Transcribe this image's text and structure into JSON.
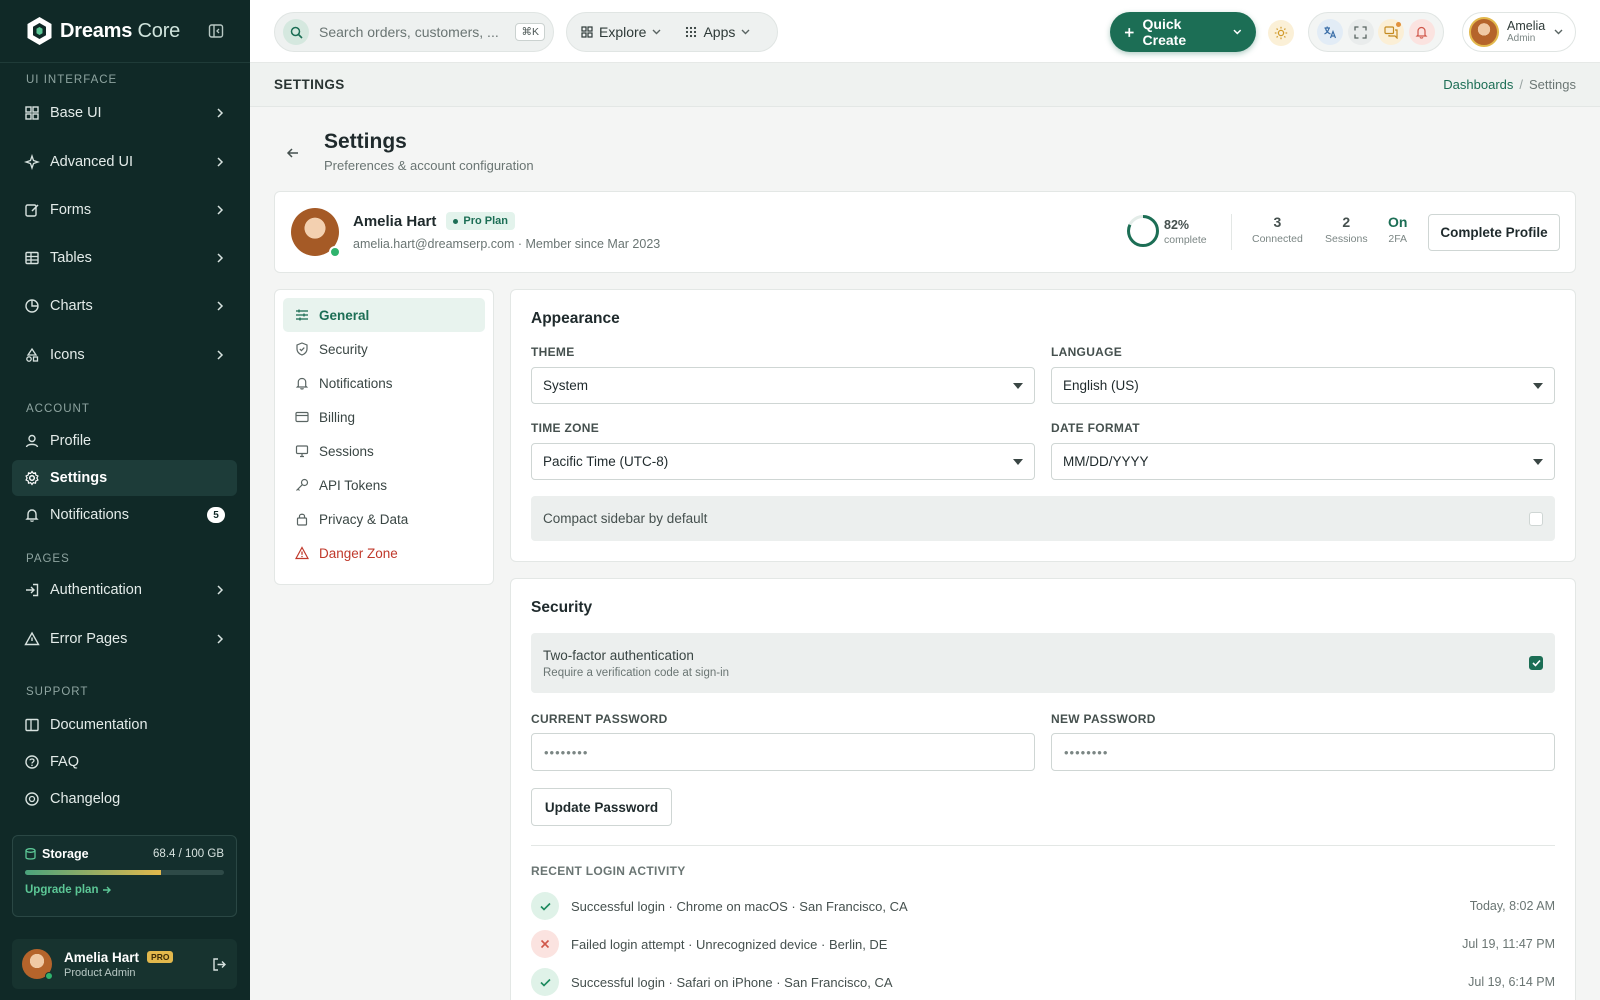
{
  "brand": {
    "name_a": "Dreams",
    "name_b": " Core"
  },
  "sidebar": {
    "sections": {
      "ui": "UI INTERFACE",
      "account": "ACCOUNT",
      "pages": "PAGES",
      "support": "SUPPORT"
    },
    "ui_items": [
      {
        "label": "Base UI",
        "icon": "grid-icon"
      },
      {
        "label": "Advanced UI",
        "icon": "sparkle-icon"
      },
      {
        "label": "Forms",
        "icon": "edit-icon"
      },
      {
        "label": "Tables",
        "icon": "table-icon"
      },
      {
        "label": "Charts",
        "icon": "chart-icon"
      },
      {
        "label": "Icons",
        "icon": "shapes-icon"
      }
    ],
    "account_items": [
      {
        "label": "Profile",
        "icon": "user-icon"
      },
      {
        "label": "Settings",
        "icon": "gear-icon",
        "active": true
      },
      {
        "label": "Notifications",
        "icon": "bell-icon",
        "badge": "5"
      }
    ],
    "pages_items": [
      {
        "label": "Authentication",
        "icon": "login-icon"
      },
      {
        "label": "Error Pages",
        "icon": "warning-icon"
      }
    ],
    "support_items": [
      {
        "label": "Documentation",
        "icon": "book-icon"
      },
      {
        "label": "FAQ",
        "icon": "help-icon"
      },
      {
        "label": "Changelog",
        "icon": "changelog-icon"
      }
    ],
    "storage": {
      "label": "Storage",
      "value": "68.4 / 100 GB",
      "used_fraction": 0.684,
      "upgrade": "Upgrade plan"
    },
    "user": {
      "name": "Amelia Hart",
      "badge": "PRO",
      "role": "Product Admin"
    }
  },
  "topbar": {
    "search_placeholder": "Search orders, customers, ...",
    "shortcut": "⌘K",
    "explore": "Explore",
    "apps": "Apps",
    "quick_create": "Quick Create",
    "user_name": "Amelia",
    "user_role": "Admin"
  },
  "page_header": {
    "title": "SETTINGS",
    "crumb_link": "Dashboards",
    "crumb_sep": "/",
    "crumb_current": "Settings"
  },
  "heading": {
    "title": "Settings",
    "subtitle": "Preferences & account configuration"
  },
  "profile": {
    "name": "Amelia Hart",
    "plan": "Pro Plan",
    "meta": "amelia.hart@dreamserp.com · Member since Mar 2023",
    "completion_pct": "82%",
    "completion_fraction": 0.82,
    "completion_label": "complete",
    "stats": [
      {
        "num": "3",
        "label": "Connected"
      },
      {
        "num": "2",
        "label": "Sessions"
      },
      {
        "num": "On",
        "label": "2FA"
      }
    ],
    "button": "Complete Profile"
  },
  "settings_nav": [
    {
      "label": "General",
      "icon": "sliders-icon",
      "active": true
    },
    {
      "label": "Security",
      "icon": "shield-icon"
    },
    {
      "label": "Notifications",
      "icon": "bell-icon"
    },
    {
      "label": "Billing",
      "icon": "card-icon"
    },
    {
      "label": "Sessions",
      "icon": "monitor-icon"
    },
    {
      "label": "API Tokens",
      "icon": "key-icon"
    },
    {
      "label": "Privacy & Data",
      "icon": "lock-icon"
    },
    {
      "label": "Danger Zone",
      "icon": "warning-icon",
      "danger": true
    }
  ],
  "appearance": {
    "title": "Appearance",
    "theme_label": "THEME",
    "theme_value": "System",
    "language_label": "LANGUAGE",
    "language_value": "English (US)",
    "timezone_label": "TIME ZONE",
    "timezone_value": "Pacific Time (UTC-8)",
    "dateformat_label": "DATE FORMAT",
    "dateformat_value": "MM/DD/YYYY",
    "compact_label": "Compact sidebar by default"
  },
  "security": {
    "title": "Security",
    "twofa_title": "Two-factor authentication",
    "twofa_desc": "Require a verification code at sign-in",
    "current_pwd_label": "CURRENT PASSWORD",
    "new_pwd_label": "NEW PASSWORD",
    "pwd_mask": "••••••••",
    "update_button": "Update Password",
    "activity_label": "RECENT LOGIN ACTIVITY",
    "activity": [
      {
        "text": "Successful login · Chrome on macOS · San Francisco, CA",
        "time": "Today, 8:02 AM",
        "status": "ok"
      },
      {
        "text": "Failed login attempt · Unrecognized device · Berlin, DE",
        "time": "Jul 19, 11:47 PM",
        "status": "bad"
      },
      {
        "text": "Successful login · Safari on iPhone · San Francisco, CA",
        "time": "Jul 19, 6:14 PM",
        "status": "ok"
      }
    ]
  },
  "colors": {
    "brand": "#1c6e55",
    "sidebar": "#102927",
    "danger": "#c0392b",
    "accent": "#e2b84c"
  }
}
